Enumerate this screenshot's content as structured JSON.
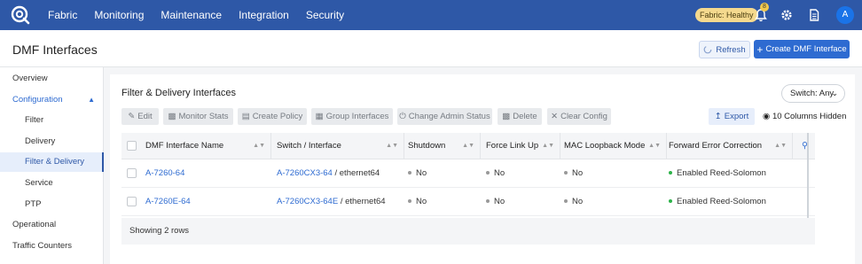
{
  "nav": {
    "items": [
      "Fabric",
      "Monitoring",
      "Maintenance",
      "Integration",
      "Security"
    ]
  },
  "topbar": {
    "fabric_status": "Fabric: Healthy",
    "notification_count": "8",
    "avatar_initial": "A"
  },
  "header": {
    "title": "DMF Interfaces",
    "refresh_label": "Refresh",
    "create_label": "Create DMF Interface"
  },
  "sidebar": {
    "overview": "Overview",
    "configuration": "Configuration",
    "config_items": [
      "Filter",
      "Delivery",
      "Filter & Delivery",
      "Service",
      "PTP"
    ],
    "operational": "Operational",
    "traffic_counters": "Traffic Counters"
  },
  "card": {
    "title": "Filter & Delivery Interfaces",
    "switch_select": "Switch: Any",
    "toolbar": [
      "Edit",
      "Monitor Stats",
      "Create Policy",
      "Group Interfaces",
      "Change Admin Status",
      "Delete",
      "Clear Config"
    ],
    "export_label": "Export",
    "hidden_columns": "10 Columns Hidden"
  },
  "table": {
    "columns": [
      "DMF Interface Name",
      "Switch / Interface",
      "Shutdown",
      "Force Link Up",
      "MAC Loopback Mode",
      "Forward Error Correction"
    ],
    "rows": [
      {
        "name": "A-7260-64",
        "switch": "A-7260CX3-64",
        "interface": " / ethernet64",
        "shutdown": "No",
        "force_link_up": "No",
        "mac_loopback": "No",
        "fec": "Enabled Reed-Solomon"
      },
      {
        "name": "A-7260E-64",
        "switch": "A-7260CX3-64E",
        "interface": " / ethernet64",
        "shutdown": "No",
        "force_link_up": "No",
        "mac_loopback": "No",
        "fec": "Enabled Reed-Solomon"
      }
    ],
    "footer": "Showing 2 rows"
  },
  "colors": {
    "brand": "#2e58a7",
    "primary": "#2e6bd1",
    "status_ok": "#2db34a",
    "pill": "#f5d98e"
  },
  "icons": [
    "logo-icon",
    "bell-icon",
    "gear-icon",
    "document-icon",
    "refresh-spinner-icon",
    "plus-icon",
    "chevron-up-icon",
    "chevron-down-icon",
    "pencil-icon",
    "bar-chart-icon",
    "document-icon",
    "grid-icon",
    "power-icon",
    "trash-icon",
    "x-icon",
    "export-icon",
    "eye-icon",
    "sort-icon",
    "search-icon"
  ]
}
